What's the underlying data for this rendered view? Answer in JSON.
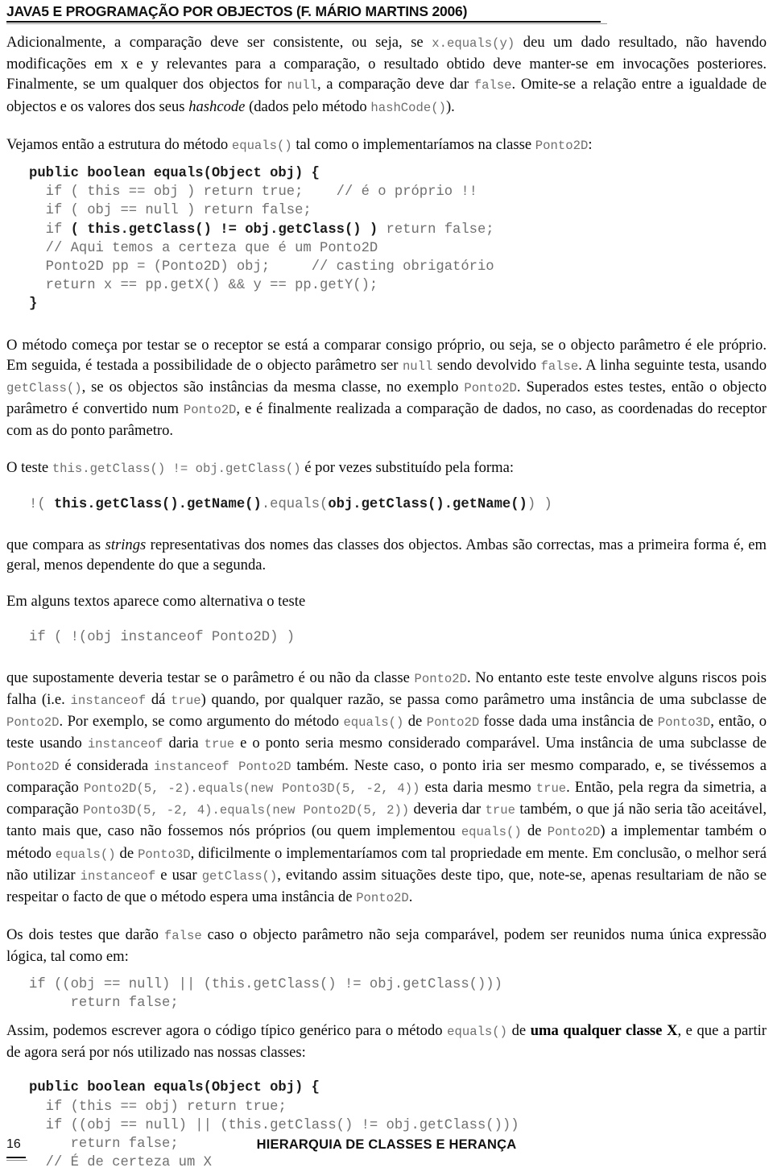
{
  "header": {
    "title": "JAVA5 E PROGRAMAÇÃO POR OBJECTOS (F. MÁRIO MARTINS 2006)"
  },
  "paragraphs": {
    "p1": {
      "s1": "Adicionalmente, a comparação deve ser consistente, ou seja, se ",
      "c1": "x.equals(y)",
      "s2": " deu um dado resultado, não havendo modificações em x e y relevantes para a comparação, o resultado obtido deve manter-se em invocações posteriores. Finalmente, se um qualquer dos objectos for ",
      "c2": "null",
      "s3": ", a comparação deve dar ",
      "c3": "false",
      "s4": ". Omite-se a relação entre a igualdade de objectos e os valores dos seus ",
      "i1": "hashcode",
      "s5": " (dados pelo método ",
      "c4": "hashCode()",
      "s6": ")."
    },
    "p2": {
      "s1": "Vejamos então a estrutura do método ",
      "c1": "equals()",
      "s2": " tal como o implementaríamos na classe ",
      "c2": "Ponto2D",
      "s3": ":"
    },
    "p3": {
      "s1": "O método começa por testar se o receptor se está a comparar consigo próprio, ou seja, se o objecto parâmetro é ele próprio. Em seguida, é testada a possibilidade de o objecto parâmetro ser ",
      "c1": "null",
      "s2": " sendo devolvido ",
      "c2": "false",
      "s3": ". A linha seguinte testa, usando ",
      "c3": "getClass()",
      "s4": ", se os objectos são instâncias da mesma classe, no exemplo ",
      "c4": "Ponto2D",
      "s5": ". Superados estes testes, então o objecto parâmetro é convertido num ",
      "c5": "Ponto2D",
      "s6": ", e é finalmente realizada a comparação de dados, no caso, as coordenadas do receptor com as do ponto parâmetro."
    },
    "p4": {
      "s1": "O teste ",
      "c1": "this.getClass() != obj.getClass()",
      "s2": " é por vezes substituído pela forma:"
    },
    "p5": {
      "s1": "que compara as ",
      "i1": "strings",
      "s2": " representativas dos nomes das classes dos objectos. Ambas são correctas, mas a primeira forma é, em geral, menos dependente do que a segunda."
    },
    "p6": {
      "s1": "Em alguns textos aparece como alternativa o teste"
    },
    "p7": {
      "s1": "que supostamente deveria testar se o parâmetro é ou não da classe ",
      "c1": "Ponto2D",
      "s2": ". No entanto este teste envolve alguns riscos pois falha (i.e. ",
      "c2": "instanceof",
      "s3": " dá ",
      "c3": "true",
      "s4": ") quando, por qualquer razão, se passa como parâmetro uma instância de uma subclasse de ",
      "c4": "Ponto2D",
      "s5": ". Por exemplo, se como argumento do método ",
      "c5": "equals()",
      "s6": " de ",
      "c6": "Ponto2D",
      "s7": " fosse dada uma instância de ",
      "c7": "Ponto3D",
      "s8": ", então, o teste usando ",
      "c8": "instanceof",
      "s9": " daria ",
      "c9": "true",
      "s10": " e o ponto seria mesmo considerado comparável. Uma instância de uma subclasse de ",
      "c10": "Ponto2D",
      "s11": " é considerada ",
      "c11": "instanceof Ponto2D",
      "s12": " também. Neste caso, o ponto iria ser mesmo comparado, e, se tivéssemos a comparação ",
      "c12": "Ponto2D(5, -2).equals(new Ponto3D(5, -2, 4))",
      "s13": " esta daria mesmo ",
      "c13": "true",
      "s14": ". Então, pela regra da simetria, a comparação ",
      "c14": "Ponto3D(5, -2, 4).equals(new Ponto2D(5, 2))",
      "s15": " deveria dar ",
      "c15": "true",
      "s16": " também, o que já não seria tão aceitável, tanto mais que, caso não fossemos nós próprios (ou quem implementou ",
      "c16": "equals()",
      "s17": " de ",
      "c17": "Ponto2D",
      "s18": ") a implementar também o método ",
      "c18": "equals()",
      "s19": " de ",
      "c19": "Ponto3D",
      "s20": ", dificilmente o implementaríamos com tal propriedade em mente. Em conclusão, o melhor será não utilizar ",
      "c20": "instanceof",
      "s21": " e usar ",
      "c21": "getClass()",
      "s22": ", evitando assim situações deste tipo, que, note-se, apenas resultariam de não se respeitar o facto de que o método espera uma instância de ",
      "c22": "Ponto2D",
      "s23": "."
    },
    "p8": {
      "s1": "Os dois testes que darão ",
      "c1": "false",
      "s2": " caso o objecto parâmetro não seja comparável, podem ser reunidos numa única expressão lógica, tal como em:"
    },
    "p9": {
      "s1": "Assim, podemos escrever agora o código típico genérico para o método ",
      "c1": "equals()",
      "s2": " de ",
      "b1": "uma qualquer classe X",
      "s3": ", e que a partir de agora será por nós utilizado nas nossas classes:"
    }
  },
  "code_block_1": {
    "lines": [
      {
        "bold": "public boolean equals(Object obj) {",
        "plain": ""
      },
      {
        "indent": "  ",
        "plain": "if ( this == obj ) return true;    // é o próprio !!"
      },
      {
        "indent": "  ",
        "plain": "if ( obj == null ) return false;"
      },
      {
        "indent": "  ",
        "pre": "if ",
        "bold": "( this.getClass() != obj.getClass() )",
        "post": " return false;"
      },
      {
        "indent": "  ",
        "plain": "// Aqui temos a certeza que é um Ponto2D"
      },
      {
        "indent": "  ",
        "plain": "Ponto2D pp = (Ponto2D) obj;     // casting obrigatório"
      },
      {
        "indent": "  ",
        "plain": "return x == pp.getX() && y == pp.getY();"
      },
      {
        "plain": "}"
      }
    ]
  },
  "snippet_getname": {
    "pre": "!( ",
    "b1": "this.getClass().getName()",
    "mid": ".equals(",
    "b2": "obj.getClass().getName()",
    "post": ") )"
  },
  "snippet_instanceof": {
    "line": "if ( !(obj instanceof Ponto2D) )"
  },
  "snippet_logic": {
    "line1": "if ((obj == null) || (this.getClass() != obj.getClass()))",
    "line2": "     return false;"
  },
  "code_block_2": {
    "lines": [
      {
        "bold": "public boolean equals(Object obj) {",
        "plain": ""
      },
      {
        "indent": "  ",
        "plain": "if (this == obj) return true;"
      },
      {
        "indent": "  ",
        "plain": "if ((obj == null) || (this.getClass() != obj.getClass()))"
      },
      {
        "indent": "  ",
        "plain": "   return false;"
      },
      {
        "indent": "  ",
        "plain": "// É de certeza um X"
      }
    ]
  },
  "footer": {
    "page_number": "16",
    "title": "HIERARQUIA DE CLASSES E HERANÇA"
  }
}
